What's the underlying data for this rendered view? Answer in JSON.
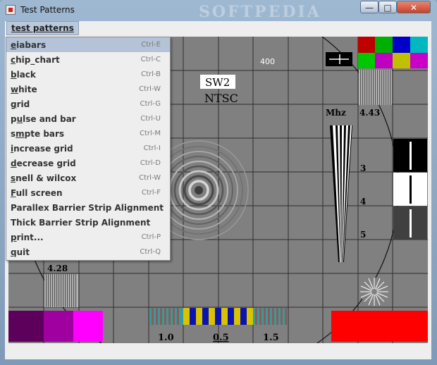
{
  "window": {
    "title": "Test Patterns",
    "watermark": "SOFTPEDIA",
    "buttons": {
      "minimize": "—",
      "maximize": "□",
      "close": "✕"
    }
  },
  "menubar": {
    "menu_label": "test patterns"
  },
  "menu": {
    "items": [
      {
        "label": "eiabars",
        "mnemonic": "e",
        "accel": "Ctrl-E",
        "selected": true
      },
      {
        "label": "chip_chart",
        "mnemonic": "c",
        "accel": "Ctrl-C"
      },
      {
        "label": "black",
        "mnemonic": "b",
        "accel": "Ctrl-B"
      },
      {
        "label": "white",
        "mnemonic": "w",
        "accel": "Ctrl-W"
      },
      {
        "label": "grid",
        "mnemonic": "g",
        "accel": "Ctrl-G"
      },
      {
        "label": "pulse and bar",
        "mnemonic": "u",
        "accel": "Ctrl-U"
      },
      {
        "label": "smpte bars",
        "mnemonic": "m",
        "accel": "Ctrl-M"
      },
      {
        "label": "increase grid",
        "mnemonic": "i",
        "accel": "Ctrl-I"
      },
      {
        "label": "decrease grid",
        "mnemonic": "d",
        "accel": "Ctrl-D"
      },
      {
        "label": "snell & wilcox",
        "mnemonic": "s",
        "accel": "Ctrl-W"
      },
      {
        "label": "Full screen",
        "mnemonic": "F",
        "accel": "Ctrl-F"
      },
      {
        "label": "Parallex Barrier Strip Alignment",
        "mnemonic": "",
        "accel": ""
      },
      {
        "label": "Thick Barrier Strip Alignment",
        "mnemonic": "",
        "accel": ""
      },
      {
        "label": "print...",
        "mnemonic": "p",
        "accel": "Ctrl-P"
      },
      {
        "label": "quit",
        "mnemonic": "q",
        "accel": "Ctrl-Q"
      }
    ]
  },
  "pattern": {
    "sw_label": "SW2",
    "ntsc_label": "NTSC",
    "top_number": "400",
    "mhz_label": "Mhz",
    "freq_443": "4.43",
    "freq_428": "4.28",
    "scale": [
      "3",
      "4",
      "5"
    ],
    "bottom_ticks": [
      "1.0",
      "0.5",
      "1.5"
    ],
    "colors": {
      "background": "#808080",
      "grid_line": "#2e2e2e",
      "purple": "#5c005c",
      "magenta": "#a000a0",
      "fuchsia": "#ff00ff",
      "red_block": "#ff0000",
      "teal": "#3a9a9a",
      "yellow": "#d9c200",
      "blue": "#0b14b0"
    }
  }
}
